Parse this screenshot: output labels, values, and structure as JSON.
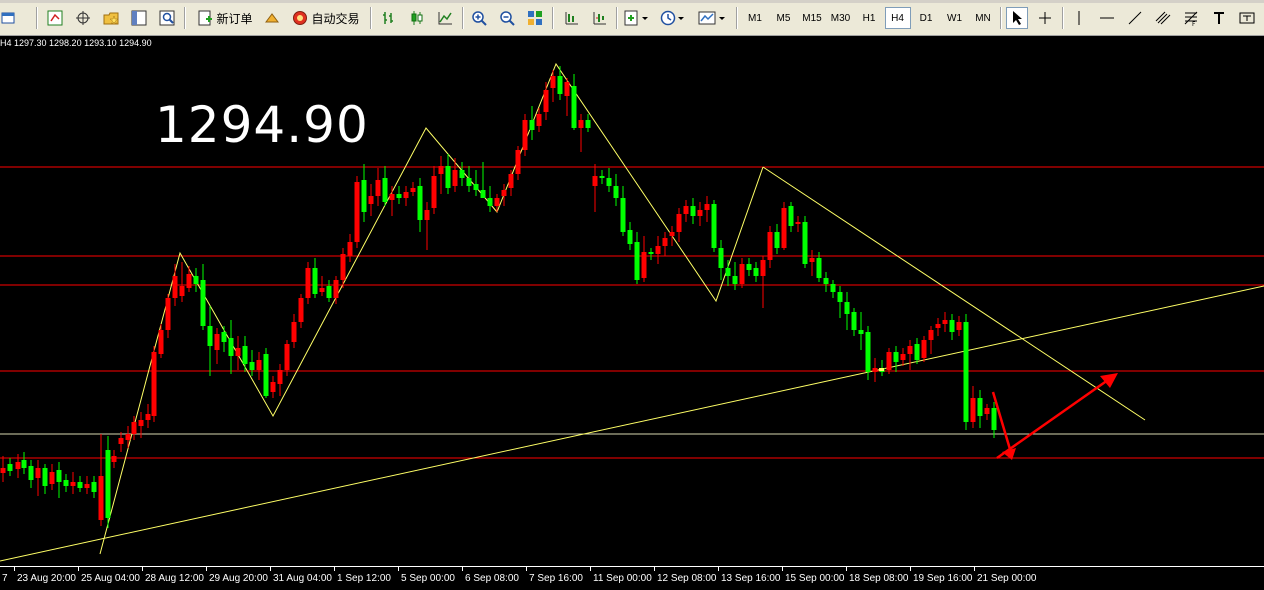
{
  "toolbar": {
    "new_order_label": "新订单",
    "auto_trade_label": "自动交易",
    "timeframes": [
      "M1",
      "M5",
      "M15",
      "M30",
      "H1",
      "H4",
      "D1",
      "W1",
      "MN"
    ],
    "active_timeframe": "H4"
  },
  "chart": {
    "ohlc_info": "H4  1297.30 1298.20 1293.10 1294.90",
    "big_price": "1294.90",
    "x_axis_labels": [
      "23 Aug 20:00",
      "25 Aug 04:00",
      "28 Aug 12:00",
      "29 Aug 20:00",
      "31 Aug 04:00",
      "1 Sep 12:00",
      "5 Sep 00:00",
      "6 Sep 08:00",
      "7 Sep 16:00",
      "11 Sep 00:00",
      "12 Sep 08:00",
      "13 Sep 16:00",
      "15 Sep 00:00",
      "18 Sep 08:00",
      "19 Sep 16:00",
      "21 Sep 00:00"
    ],
    "x_axis_edge_label": "7",
    "colors": {
      "background": "#000000",
      "bull": "#FF0000",
      "bear": "#00FF00",
      "trendline": "#FFFF66",
      "level": "#FF0000",
      "arrow": "#FF0000"
    }
  }
}
